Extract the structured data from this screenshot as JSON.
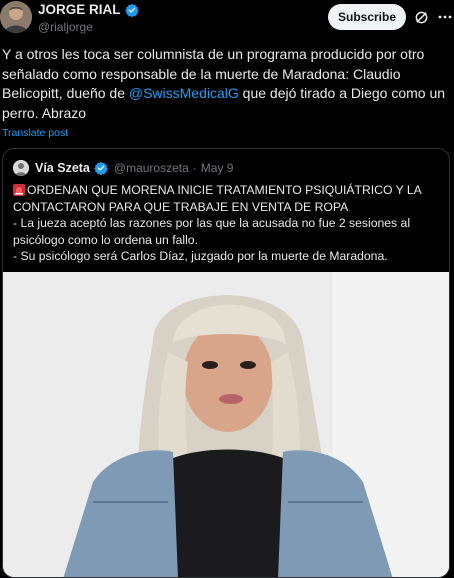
{
  "author": {
    "name": "JORGE RIAL",
    "handle": "@rialjorge",
    "verified": true
  },
  "actions": {
    "subscribe_label": "Subscribe",
    "icons": [
      "grok-icon",
      "more-icon"
    ]
  },
  "tweet": {
    "text_before": "Y a otros les toca ser columnista de un programa producido por otro señalado como responsable de la muerte de Maradona: Claudio Belicopitt, dueño de ",
    "mention": "@SwissMedicalG",
    "text_after": " que dejó tirado a Diego como un perro. Abrazo",
    "translate_label": "Translate post"
  },
  "quote": {
    "name": "Vía Szeta",
    "handle": "@mauroszeta",
    "separator": "·",
    "date": "May 9",
    "lines": [
      "ORDENAN QUE MORENA INICIE TRATAMIENTO PSIQUIÁTRICO Y LA",
      "CONTACTARON PARA QUE TRABAJE EN VENTA DE ROPA",
      "- La jueza aceptó las razones por las que la acusada no fue 2 sesiones al",
      "psicólogo como lo ordena un fallo.",
      "- Su psicólogo será Carlos Díaz, juzgado por la muerte de Maradona."
    ],
    "lead_icon": "siren-icon"
  },
  "colors": {
    "background": "#000000",
    "text": "#e7e9ea",
    "muted": "#71767b",
    "link": "#1d9bf0",
    "verified": "#1d9bf0",
    "border": "#2f3336"
  }
}
